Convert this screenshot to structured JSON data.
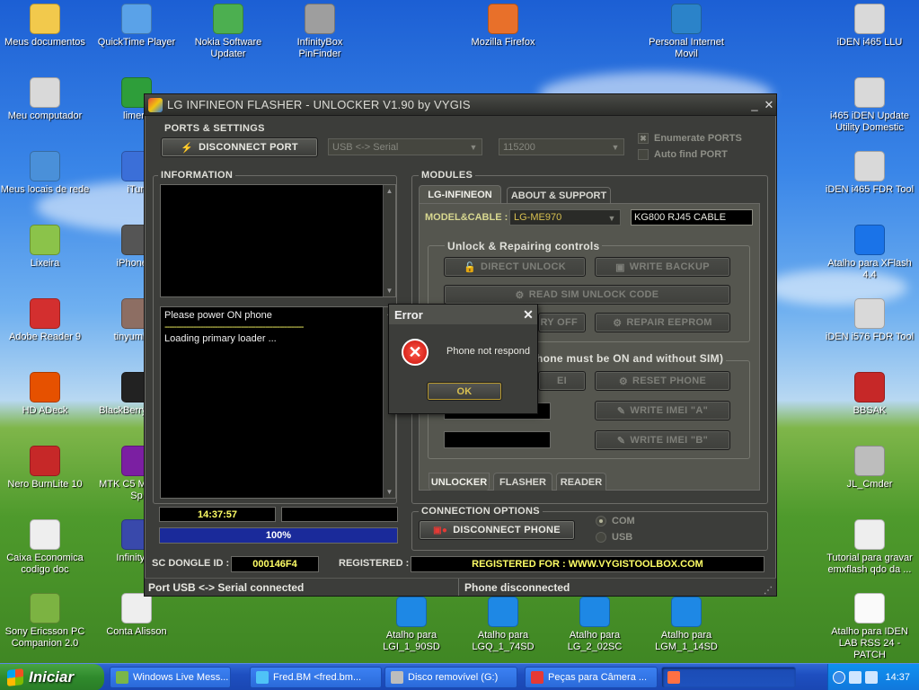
{
  "desktop_icons": [
    {
      "label": "Meus documentos",
      "icon": "folder-icon",
      "color": "#f2c94c"
    },
    {
      "label": "QuickTime Player",
      "icon": "quicktime-icon",
      "color": "#5aa2e8"
    },
    {
      "label": "Nokia Software Updater",
      "icon": "nokia-icon",
      "color": "#4caf50"
    },
    {
      "label": "InfinityBox PinFinder",
      "icon": "infinitybox-icon",
      "color": "#9e9e9e"
    },
    {
      "label": "Mozilla Firefox",
      "icon": "firefox-icon",
      "color": "#e8702a"
    },
    {
      "label": "Personal Internet Movil",
      "icon": "3g-icon",
      "color": "#2b83c9"
    },
    {
      "label": "iDEN i465 LLU",
      "icon": "computer-icon",
      "color": "#d9d9d9"
    },
    {
      "label": "Meu computador",
      "icon": "computer-icon",
      "color": "#d9d9d9"
    },
    {
      "label": "limera",
      "icon": "limewire-icon",
      "color": "#2e9e3a"
    },
    {
      "label": "i465 iDEN Update Utility Domestic",
      "icon": "computer-icon",
      "color": "#d9d9d9"
    },
    {
      "label": "Meus locais de rede",
      "icon": "network-icon",
      "color": "#4a90d9"
    },
    {
      "label": "iTun",
      "icon": "itunes-icon",
      "color": "#3b6fd8"
    },
    {
      "label": "iDEN i465 FDR Tool",
      "icon": "computer-icon",
      "color": "#d9d9d9"
    },
    {
      "label": "Lixeira",
      "icon": "recycle-bin-icon",
      "color": "#8bc34a"
    },
    {
      "label": "iPhone E",
      "icon": "iphone-icon",
      "color": "#555555"
    },
    {
      "label": "Atalho para XFlash 4.4",
      "icon": "xflash-icon",
      "color": "#1a73e8"
    },
    {
      "label": "Adobe Reader 9",
      "icon": "adobe-reader-icon",
      "color": "#d32f2f"
    },
    {
      "label": "tinyumbrel",
      "icon": "umbrella-icon",
      "color": "#8d6e63"
    },
    {
      "label": "iDEN i576 FDR Tool",
      "icon": "computer-icon",
      "color": "#d9d9d9"
    },
    {
      "label": "HD ADeck",
      "icon": "hd-adeck-icon",
      "color": "#e65100"
    },
    {
      "label": "BlackBerry Softw",
      "icon": "blackberry-icon",
      "color": "#222222"
    },
    {
      "label": "BBSAK",
      "icon": "swiss-knife-icon",
      "color": "#c62828"
    },
    {
      "label": "Nero BurnLite 10",
      "icon": "nero-icon",
      "color": "#c62828"
    },
    {
      "label": "MTK C5 MT6235 Sp",
      "icon": "winrar-icon",
      "color": "#7b1fa2"
    },
    {
      "label": "JL_Cmder",
      "icon": "jl-cmder-icon",
      "color": "#bdbdbd"
    },
    {
      "label": "Caixa Economica codigo doc",
      "icon": "document-icon",
      "color": "#eeeeee"
    },
    {
      "label": "InfinityBo",
      "icon": "infinitybox-icon",
      "color": "#3949ab"
    },
    {
      "label": "Tutorial para gravar emxflash qdo da ...",
      "icon": "document-icon",
      "color": "#eeeeee"
    },
    {
      "label": "Sony Ericsson PC Companion 2.0",
      "icon": "sony-ericsson-icon",
      "color": "#7cb342"
    },
    {
      "label": "Conta Alisson",
      "icon": "document-icon",
      "color": "#eeeeee"
    },
    {
      "label": "Atalho para LGI_1_90SD",
      "icon": "lg-shortcut-icon",
      "color": "#1e88e5"
    },
    {
      "label": "Atalho para LGQ_1_74SD",
      "icon": "lg-shortcut-icon",
      "color": "#1e88e5"
    },
    {
      "label": "Atalho para LG_2_02SC",
      "icon": "lg-shortcut-icon",
      "color": "#1e88e5"
    },
    {
      "label": "Atalho para LGM_1_14SD",
      "icon": "lg-shortcut-icon",
      "color": "#1e88e5"
    },
    {
      "label": "Atalho para IDEN LAB RSS 24 - PATCH",
      "icon": "skull-icon",
      "color": "#fafafa"
    }
  ],
  "window": {
    "title": "LG INFINEON  FLASHER - UNLOCKER V1.90 by VYGIS",
    "minimize": "_",
    "close": "✕",
    "ports": {
      "label": "PORTS & SETTINGS",
      "disconnect_port": "DISCONNECT PORT",
      "port_type": "USB <-> Serial",
      "baud": "115200",
      "enumerate": "Enumerate PORTS",
      "enumerate_checked": true,
      "autofind": "Auto find PORT",
      "autofind_checked": false
    },
    "information": {
      "label": "INFORMATION",
      "log_lines": [
        "Please power ON phone",
        "----------------------------------------------------------",
        "Loading primary loader ..."
      ],
      "time": "14:37:57",
      "progress_text": "100%",
      "progress": 1.0
    },
    "modules": {
      "label": "MODULES",
      "tabs": [
        "LG-INFINEON",
        "ABOUT & SUPPORT"
      ],
      "active_tab": 0,
      "model_label": "MODEL&CABLE :",
      "model": "LG-ME970",
      "cable": "KG800 RJ45 CABLE",
      "unlock_group": "Unlock & Repairing controls",
      "direct_unlock": "DIRECT UNLOCK",
      "write_backup": "WRITE BACKUP",
      "read_sim": "READ SIM UNLOCK CODE",
      "battery_off": "RY OFF",
      "repair_eeprom": "REPAIR EEPROM",
      "imei_group": "hone must be ON and without SIM)",
      "imei_btn": "EI",
      "reset_phone": "RESET PHONE",
      "write_imei_a": "WRITE IMEI \"A\"",
      "write_imei_b": "WRITE IMEI \"B\"",
      "bottom_tabs": [
        "UNLOCKER",
        "FLASHER",
        "READER"
      ]
    },
    "connection": {
      "label": "CONNECTION OPTIONS",
      "disconnect_phone": "DISCONNECT PHONE",
      "com": "COM",
      "usb": "USB"
    },
    "dongle_label": "SC DONGLE ID :",
    "dongle_id": "000146F4",
    "registered_label": "REGISTERED :",
    "registered_value": "REGISTERED FOR : WWW.VYGISTOOLBOX.COM",
    "status_left": "Port USB <-> Serial connected",
    "status_right": "Phone disconnected"
  },
  "dialog": {
    "title": "Error",
    "close": "✕",
    "message": "Phone not respond",
    "ok": "OK"
  },
  "taskbar": {
    "start": "Iniciar",
    "tasks": [
      {
        "label": "Windows Live Mess...",
        "color": "#7ab648"
      },
      {
        "label": "Fred.BM <fred.bm...",
        "color": "#4fc3f7"
      },
      {
        "label": "Disco removível (G:)",
        "color": "#bdbdbd"
      },
      {
        "label": "Peças para Câmera ...",
        "color": "#e53935"
      },
      {
        "label": "",
        "color": "#ff7043"
      }
    ],
    "clock": "14:37"
  }
}
